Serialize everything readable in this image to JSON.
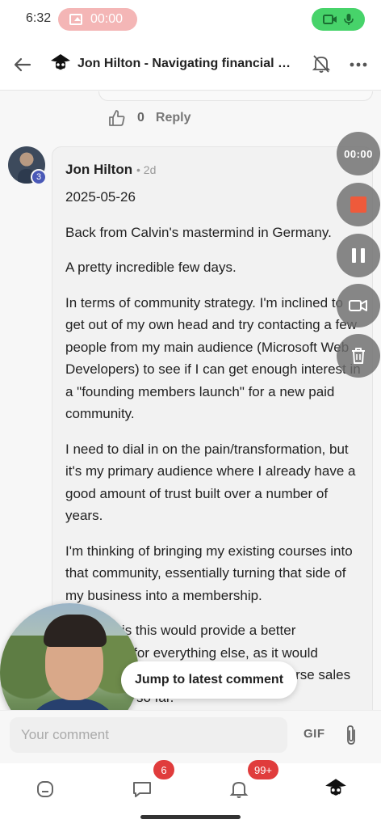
{
  "status_bar": {
    "time": "6:32",
    "recording_timer": "00:00",
    "accent_recording": "#f4b6b6",
    "accent_camera": "#47d36a"
  },
  "header": {
    "title": "Jon Hilton - Navigating financial pr...",
    "icons": [
      "back-arrow-icon",
      "topic-avatar-icon",
      "bell-muted-icon",
      "more-icon"
    ]
  },
  "previous_post": {
    "like_count": "0",
    "reply_label": "Reply"
  },
  "post": {
    "author": "Jon Hilton",
    "age": "2d",
    "avatar_badge": "3",
    "paragraphs": [
      "2025-05-26",
      "Back from Calvin's mastermind in Germany.",
      "A pretty incredible few days.",
      "In terms of community strategy. I'm inclined to get out of my own head and try contacting a few people from my main audience (Microsoft Web Developers) to see if I can get enough interest in a \"founding members launch\" for a new paid community.",
      "I need to dial in on the pain/transformation, but it's my primary audience where I already have a good amount of trust built over a number of years.",
      "I'm thinking of bringing my existing courses into that community, essentially turning that side of my business into a membership.",
      "My hope is this would provide a better foundation for everything else, as it would reduce my reliance on the one-off course sales I've offered so far."
    ]
  },
  "recorder": {
    "timer": "00:00",
    "stop_color": "#ee5a3b"
  },
  "jump_pill": {
    "label": "Jump to latest comment"
  },
  "composer": {
    "placeholder": "Your comment",
    "gif_label": "GIF"
  },
  "bottom_nav": {
    "chat_badge": "6",
    "notifications_badge": "99+",
    "badge_color": "#e03c3c"
  }
}
